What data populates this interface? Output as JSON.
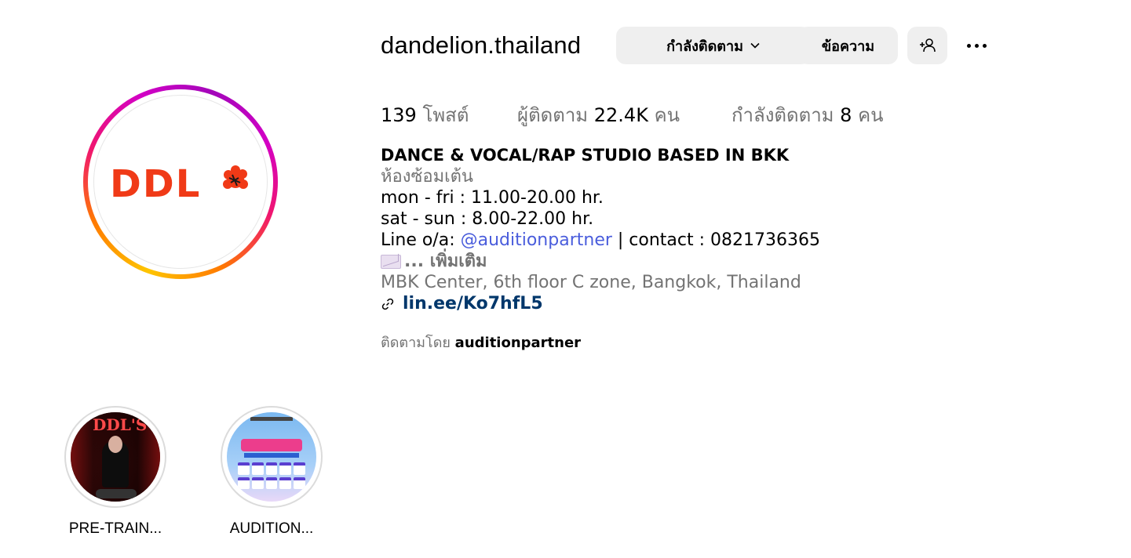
{
  "profile": {
    "username": "dandelion.thailand",
    "avatar_text": "DDL"
  },
  "actions": {
    "following_label": "กำลังติดตาม",
    "message_label": "ข้อความ"
  },
  "stats": {
    "posts_count": "139",
    "posts_label": "โพสต์",
    "followers_label": "ผู้ติดตาม",
    "followers_count": "22.4K",
    "followers_unit": "คน",
    "following_label": "กำลังติดตาม",
    "following_count": "8",
    "following_unit": "คน"
  },
  "bio": {
    "name": "DANCE & VOCAL/RAP STUDIO BASED IN BKK",
    "category": "ห้องซ้อมเต้น",
    "line1": "mon - fri : 11.00-20.00 hr.",
    "line2": "sat - sun : 8.00-22.00 hr.",
    "line3_prefix": "Line o/a: ",
    "line3_mention": "@auditionpartner",
    "line3_suffix": " | contact : 0821736365",
    "more": "... เพิ่มเติม",
    "address": "MBK Center, 6th floor C zone, Bangkok, Thailand",
    "link": "lin.ee/Ko7hfL5"
  },
  "followed_by": {
    "prefix": "ติดตามโดย ",
    "user": "auditionpartner"
  },
  "highlights": [
    {
      "label": "PRE-TRAIN...",
      "image_title": "DDL'S"
    },
    {
      "label": "AUDITION..."
    }
  ],
  "colors": {
    "link": "#00376b",
    "mention": "#4a5ddc",
    "secondary_text": "#737373",
    "button_bg": "#efefef",
    "brand_red": "#f03a17"
  },
  "icons": {
    "following_dropdown": "chevron-down-icon",
    "add_user": "add-person-icon",
    "more": "more-horizontal-icon",
    "link": "link-icon",
    "envelope": "envelope-emoji"
  }
}
